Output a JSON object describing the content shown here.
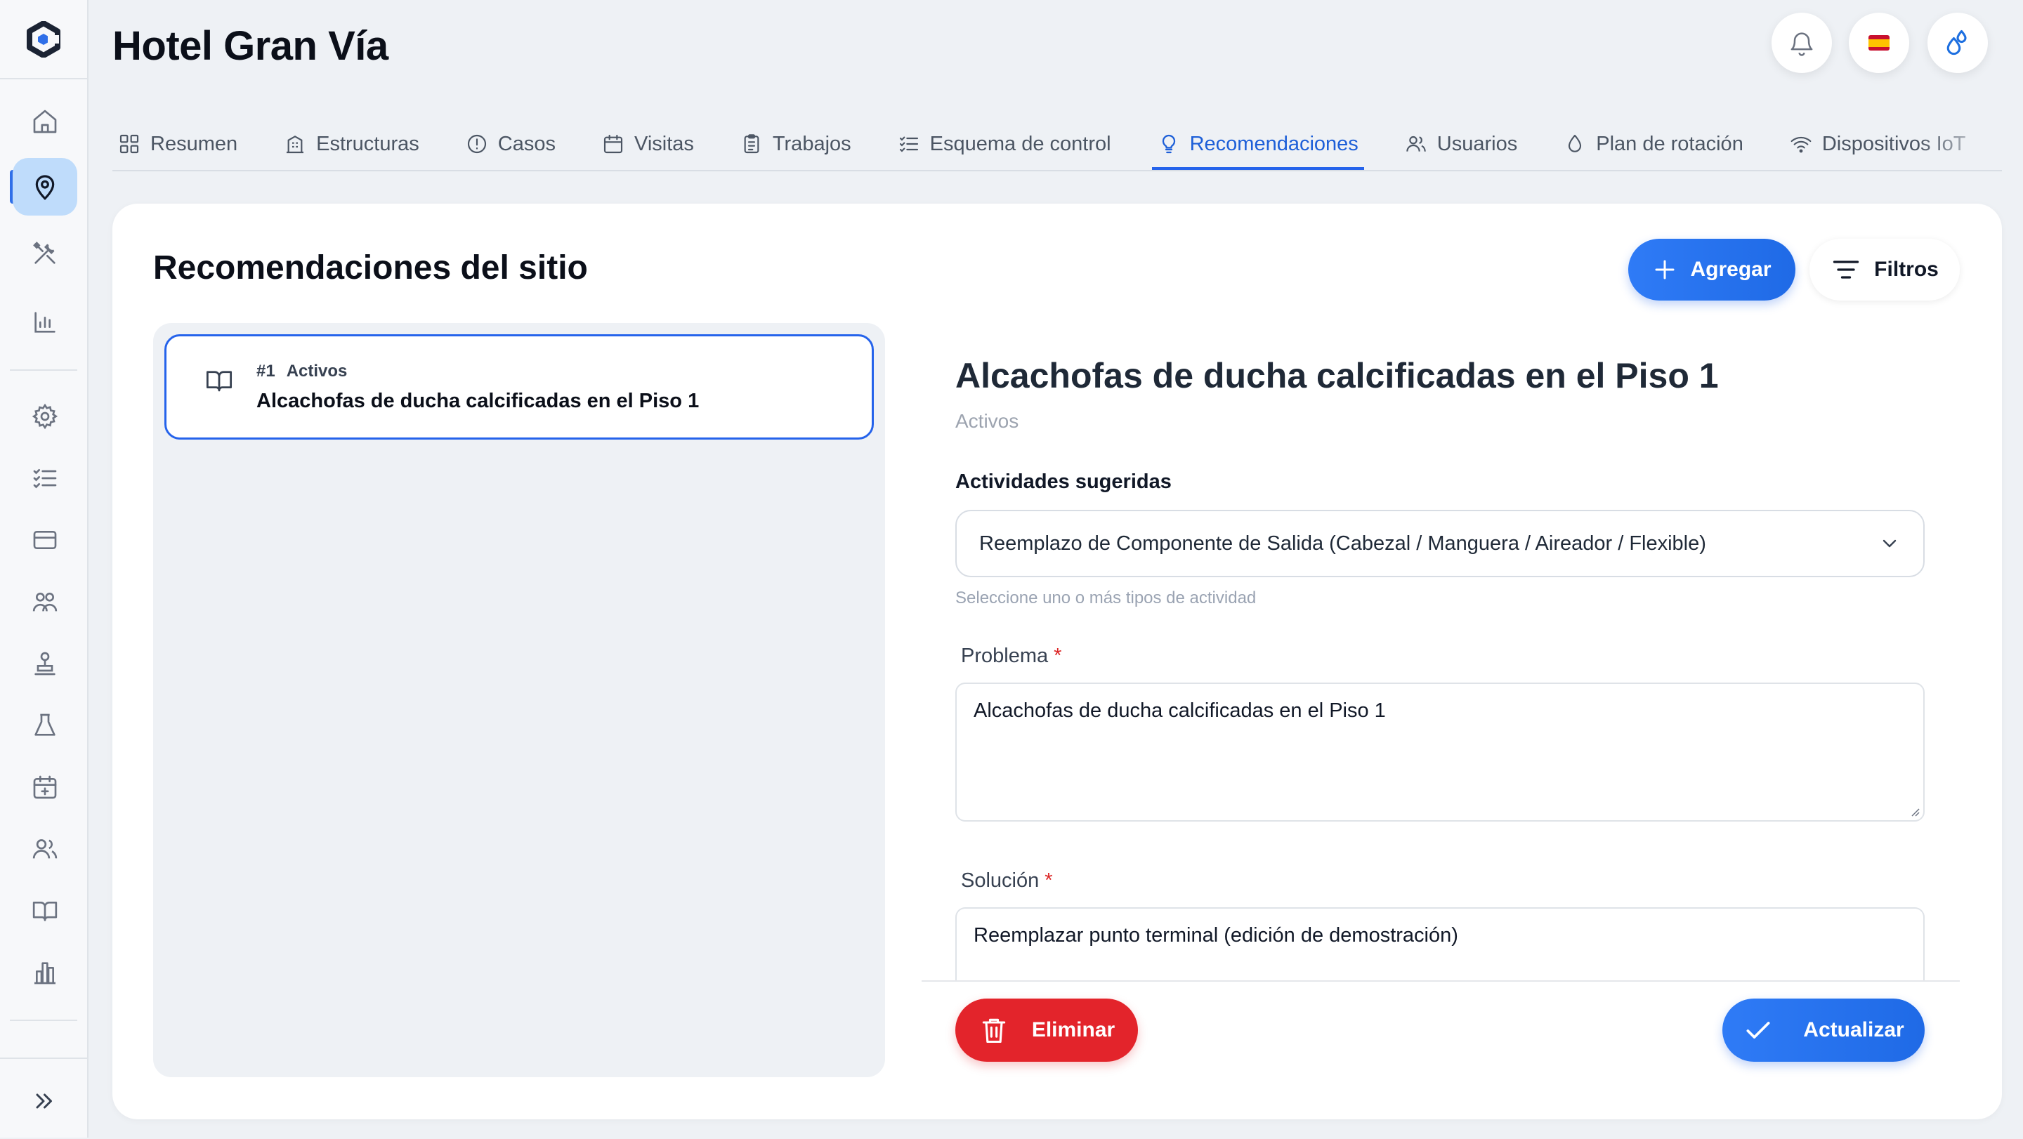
{
  "header": {
    "title": "Hotel Gran Vía",
    "language_flag": "es"
  },
  "tabs": [
    {
      "label": "Resumen",
      "icon": "grid-icon"
    },
    {
      "label": "Estructuras",
      "icon": "building-icon"
    },
    {
      "label": "Casos",
      "icon": "alert-circle-icon"
    },
    {
      "label": "Visitas",
      "icon": "calendar-icon"
    },
    {
      "label": "Trabajos",
      "icon": "clipboard-icon"
    },
    {
      "label": "Esquema de control",
      "icon": "checklist-icon"
    },
    {
      "label": "Recomendaciones",
      "icon": "lightbulb-icon",
      "active": true
    },
    {
      "label": "Usuarios",
      "icon": "users-icon"
    },
    {
      "label": "Plan de rotación",
      "icon": "droplet-icon"
    },
    {
      "label": "Dispositivos IoT",
      "icon": "wifi-icon"
    }
  ],
  "section": {
    "title": "Recomendaciones del sitio",
    "add_label": "Agregar",
    "filter_label": "Filtros"
  },
  "list": {
    "items": [
      {
        "number": "#1",
        "status": "Activos",
        "title": "Alcachofas de ducha calcificadas en el Piso 1"
      }
    ]
  },
  "detail": {
    "title": "Alcachofas de ducha calcificadas en el Piso 1",
    "status": "Activos",
    "activities_label": "Actividades sugeridas",
    "activities_value": "Reemplazo de Componente de Salida (Cabezal / Manguera / Aireador / Flexible)",
    "activities_hint": "Seleccione uno o más tipos de actividad",
    "problem_label": "Problema",
    "problem_value": "Alcachofas de ducha calcificadas en el Piso 1",
    "solution_label": "Solución",
    "solution_value": "Reemplazar punto terminal (edición de demostración)",
    "required_mark": "*",
    "delete_label": "Eliminar",
    "update_label": "Actualizar"
  },
  "colors": {
    "accent": "#2563eb",
    "danger": "#e3242b",
    "active_nav_bg": "#bfdcfb"
  }
}
